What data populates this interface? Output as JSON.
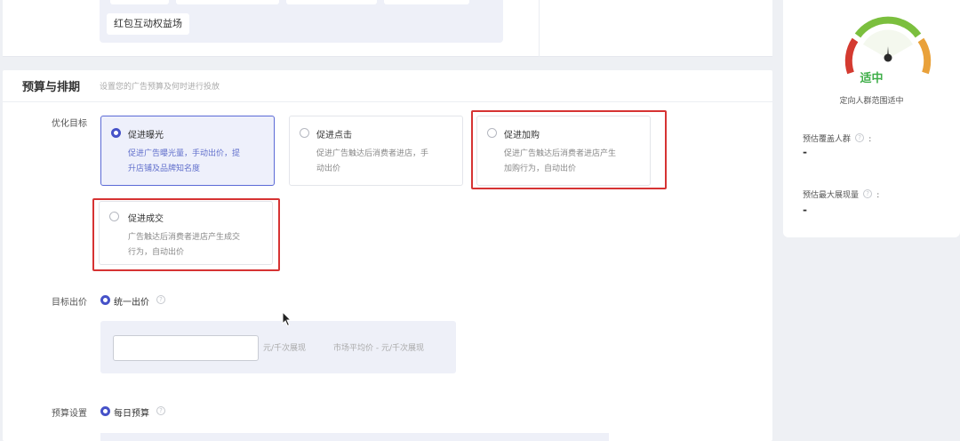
{
  "top": {
    "redpack_chip": "红包互动权益场"
  },
  "section": {
    "title": "预算与排期",
    "subtitle": "设置您的广告预算及何时进行投放"
  },
  "goal": {
    "label": "优化目标",
    "options": [
      {
        "title": "促进曝光",
        "desc_line1": "促进广告曝光量，手动出价，提",
        "desc_line2": "升店铺及品牌知名度",
        "selected": true
      },
      {
        "title": "促进点击",
        "desc_line1": "促进广告触达后消费者进店，手",
        "desc_line2": "动出价",
        "selected": false
      },
      {
        "title": "促进加购",
        "desc_line1": "促进广告触达后消费者进店产生",
        "desc_line2": "加购行为，自动出价",
        "selected": false
      },
      {
        "title": "促进成交",
        "desc_line1": "广告触达后消费者进店产生成交",
        "desc_line2": "行为，自动出价",
        "selected": false
      }
    ]
  },
  "bid": {
    "label": "目标出价",
    "mode": "统一出价",
    "input_value": "",
    "unit": "元/千次展现",
    "market_avg": "市场平均价 - 元/千次展现"
  },
  "budget": {
    "label": "预算设置",
    "mode": "每日预算"
  },
  "side": {
    "gauge_level": "适中",
    "gauge_caption": "定向人群范围适中",
    "coverage_label": "预估覆盖人群",
    "coverage_value": "-",
    "impressions_label": "预估最大展现量",
    "impressions_value": "-"
  },
  "colors": {
    "accent": "#4652c8",
    "highlight": "#d63333",
    "gauge_red": "#d43a30",
    "gauge_green": "#7bbf3e",
    "gauge_orange": "#e9a13a",
    "gauge_text": "#3fae49"
  }
}
